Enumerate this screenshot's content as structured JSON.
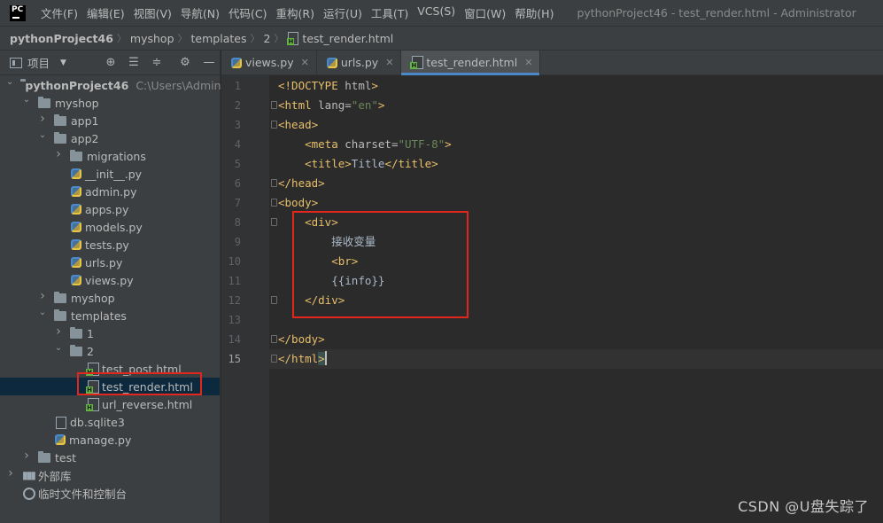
{
  "app": {
    "logo_text": "PC",
    "window_title": "pythonProject46 - test_render.html - Administrator"
  },
  "menu": [
    "文件(F)",
    "编辑(E)",
    "视图(V)",
    "导航(N)",
    "代码(C)",
    "重构(R)",
    "运行(U)",
    "工具(T)",
    "VCS(S)",
    "窗口(W)",
    "帮助(H)"
  ],
  "breadcrumb": [
    "pythonProject46",
    "myshop",
    "templates",
    "2",
    "test_render.html"
  ],
  "panel": {
    "title": "项目",
    "icons": [
      "locate-icon",
      "expand-all-icon",
      "collapse-all-icon",
      "gear-icon",
      "minimize-icon"
    ]
  },
  "tree": [
    {
      "label": "pythonProject46",
      "hint": "C:\\Users\\Adminis",
      "indent": 0,
      "arrow": "open",
      "icon": "folder",
      "bold": true
    },
    {
      "label": "myshop",
      "indent": 1,
      "arrow": "open",
      "icon": "folder"
    },
    {
      "label": "app1",
      "indent": 2,
      "arrow": "closed",
      "icon": "folder"
    },
    {
      "label": "app2",
      "indent": 2,
      "arrow": "open",
      "icon": "folder"
    },
    {
      "label": "migrations",
      "indent": 3,
      "arrow": "closed",
      "icon": "folder"
    },
    {
      "label": "__init__.py",
      "indent": 3,
      "icon": "python"
    },
    {
      "label": "admin.py",
      "indent": 3,
      "icon": "python"
    },
    {
      "label": "apps.py",
      "indent": 3,
      "icon": "python"
    },
    {
      "label": "models.py",
      "indent": 3,
      "icon": "python"
    },
    {
      "label": "tests.py",
      "indent": 3,
      "icon": "python"
    },
    {
      "label": "urls.py",
      "indent": 3,
      "icon": "python"
    },
    {
      "label": "views.py",
      "indent": 3,
      "icon": "python"
    },
    {
      "label": "myshop",
      "indent": 2,
      "arrow": "closed",
      "icon": "folder"
    },
    {
      "label": "templates",
      "indent": 2,
      "arrow": "open",
      "icon": "folder"
    },
    {
      "label": "1",
      "indent": 3,
      "arrow": "closed",
      "icon": "folder"
    },
    {
      "label": "2",
      "indent": 3,
      "arrow": "open",
      "icon": "folder"
    },
    {
      "label": "test_post.html",
      "indent": 4,
      "icon": "html"
    },
    {
      "label": "test_render.html",
      "indent": 4,
      "icon": "html",
      "selected": true
    },
    {
      "label": "url_reverse.html",
      "indent": 4,
      "icon": "html"
    },
    {
      "label": "db.sqlite3",
      "indent": 2,
      "icon": "db"
    },
    {
      "label": "manage.py",
      "indent": 2,
      "icon": "python"
    },
    {
      "label": "test",
      "indent": 1,
      "arrow": "closed",
      "icon": "folder"
    },
    {
      "label": "外部库",
      "indent": 0,
      "arrow": "closed",
      "icon": "library"
    },
    {
      "label": "临时文件和控制台",
      "indent": 0,
      "icon": "scratch"
    }
  ],
  "tabs": [
    {
      "label": "views.py",
      "icon": "python",
      "active": false
    },
    {
      "label": "urls.py",
      "icon": "python",
      "active": false
    },
    {
      "label": "test_render.html",
      "icon": "html",
      "active": true
    }
  ],
  "editor": {
    "current_line": 15,
    "lines": [
      {
        "n": "1",
        "html": "<span class=\"doctype\">&lt;!DOCTYPE </span><span class=\"attr\">html</span><span class=\"doctype\">&gt;</span>"
      },
      {
        "n": "2",
        "html": "<span class=\"tag\">&lt;html </span><span class=\"attr\">lang=</span><span class=\"val\">\"en\"</span><span class=\"tag\">&gt;</span>"
      },
      {
        "n": "3",
        "html": "<span class=\"tag\">&lt;head&gt;</span>"
      },
      {
        "n": "4",
        "html": "    <span class=\"tag\">&lt;meta </span><span class=\"attr\">charset=</span><span class=\"val\">\"UTF-8\"</span><span class=\"tag\">&gt;</span>"
      },
      {
        "n": "5",
        "html": "    <span class=\"tag\">&lt;title&gt;</span><span class=\"txt\">Title</span><span class=\"tag\">&lt;/title&gt;</span>"
      },
      {
        "n": "6",
        "html": "<span class=\"tag\">&lt;/head&gt;</span>"
      },
      {
        "n": "7",
        "html": "<span class=\"tag\">&lt;body&gt;</span>"
      },
      {
        "n": "8",
        "html": "    <span class=\"tag\">&lt;div&gt;</span>"
      },
      {
        "n": "9",
        "html": "        <span class=\"txt\">接收变量</span>"
      },
      {
        "n": "10",
        "html": "        <span class=\"tag\">&lt;br&gt;</span>"
      },
      {
        "n": "11",
        "html": "        <span class=\"txt\">{{info}}</span>"
      },
      {
        "n": "12",
        "html": "    <span class=\"tag\">&lt;/div&gt;</span>"
      },
      {
        "n": "13",
        "html": ""
      },
      {
        "n": "14",
        "html": "<span class=\"tag\">&lt;/body&gt;</span>"
      },
      {
        "n": "15",
        "html": "<span class=\"tag\">&lt;/html</span><span class=\"tag match-bg\">&gt;</span>"
      }
    ]
  },
  "watermark": "CSDN @U盘失踪了",
  "colors": {
    "annotation_box": "#e0261d",
    "accent": "#4a88c7"
  }
}
